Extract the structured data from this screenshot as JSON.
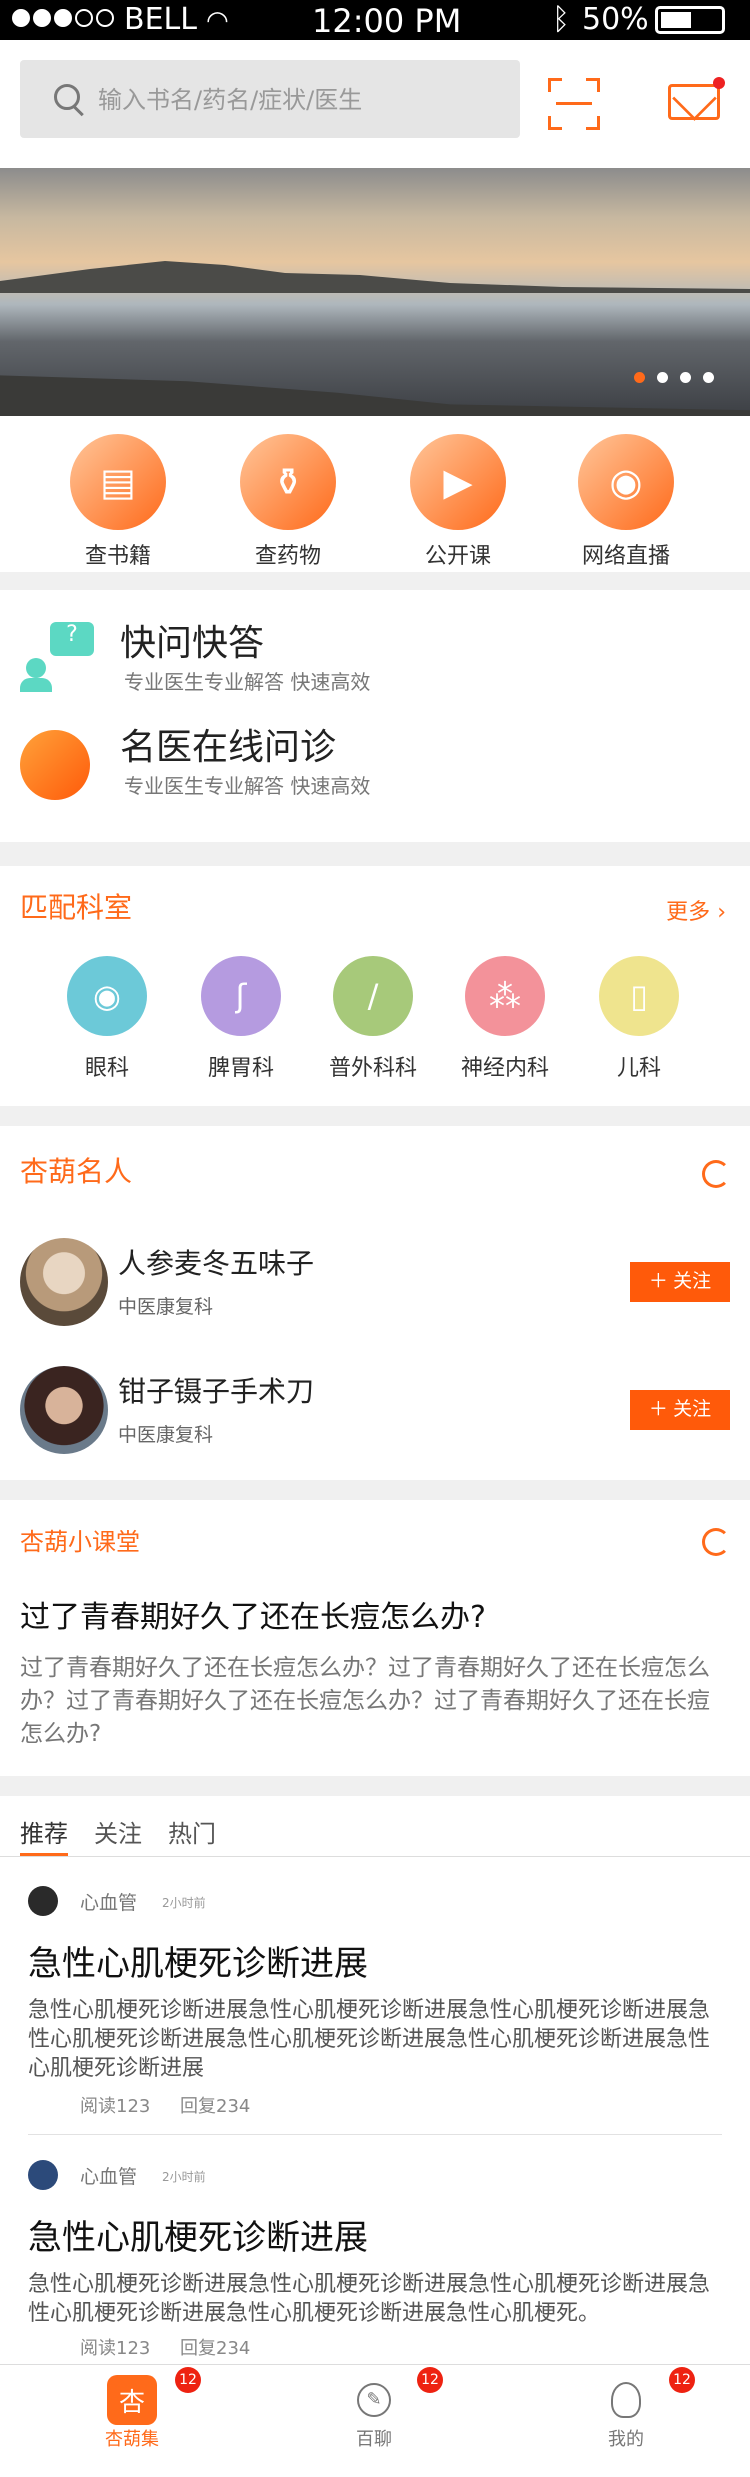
{
  "status": {
    "carrier": "BELL",
    "time": "12:00 PM",
    "battery": "50%"
  },
  "search": {
    "placeholder": "输入书名/药名/症状/医生"
  },
  "banner": {
    "page_count": 4,
    "active_index": 0
  },
  "categories": [
    {
      "label": "查书籍",
      "icon": "book-icon"
    },
    {
      "label": "查药物",
      "icon": "mortar-icon"
    },
    {
      "label": "公开课",
      "icon": "video-icon"
    },
    {
      "label": "网络直播",
      "icon": "live-icon"
    }
  ],
  "quick": [
    {
      "title": "快问快答",
      "sub": "专业医生专业解答  快速高效",
      "icon": "chat-question-icon"
    },
    {
      "title": "名医在线问诊",
      "sub": "专业医生专业解答  快速高效",
      "icon": "doctor-online-icon"
    }
  ],
  "departments": {
    "title": "匹配科室",
    "more": "更多",
    "items": [
      {
        "label": "眼科",
        "color": "#6cc9d8",
        "icon": "eye-icon"
      },
      {
        "label": "脾胃科",
        "color": "#b59be0",
        "icon": "stomach-icon"
      },
      {
        "label": "普外科科",
        "color": "#a7c97a",
        "icon": "scalpel-icon"
      },
      {
        "label": "神经内科",
        "color": "#f3929a",
        "icon": "neuron-icon"
      },
      {
        "label": "儿科",
        "color": "#efe48e",
        "icon": "bottle-icon"
      }
    ]
  },
  "famous": {
    "title": "杏葫名人",
    "people": [
      {
        "name": "人参麦冬五味子",
        "tag": "中医康复科",
        "follow": "关注"
      },
      {
        "name": "钳子镊子手术刀",
        "tag": "中医康复科",
        "follow": "关注"
      }
    ]
  },
  "klass": {
    "title": "杏葫小课堂",
    "question": "过了青春期好久了还在长痘怎么办?",
    "body": "过了青春期好久了还在长痘怎么办？过了青春期好久了还在长痘怎么办？过了青春期好久了还在长痘怎么办？过了青春期好久了还在长痘怎么办?"
  },
  "feed": {
    "tabs": [
      "推荐",
      "关注",
      "热门"
    ],
    "posts": [
      {
        "cat": "心血管",
        "time": "2小时前",
        "title": "急性心肌梗死诊断进展",
        "body": "急性心肌梗死诊断进展急性心肌梗死诊断进展急性心肌梗死诊断进展急性心肌梗死诊断进展急性心肌梗死诊断进展急性心肌梗死诊断进展急性心肌梗死诊断进展",
        "reads": "阅读123",
        "replies": "回复234"
      },
      {
        "cat": "心血管",
        "time": "2小时前",
        "title": "急性心肌梗死诊断进展",
        "body": "急性心肌梗死诊断进展急性心肌梗死诊断进展急性心肌梗死诊断进展急性心肌梗死诊断进展急性心肌梗死诊断进展急性心肌梗死。",
        "reads": "阅读123",
        "replies": "回复234"
      }
    ]
  },
  "tabbar": [
    {
      "label": "杏葫集",
      "badge": "12",
      "icon": "home-icon"
    },
    {
      "label": "百聊",
      "badge": "12",
      "icon": "chat-icon"
    },
    {
      "label": "我的",
      "badge": "12",
      "icon": "user-icon"
    }
  ]
}
